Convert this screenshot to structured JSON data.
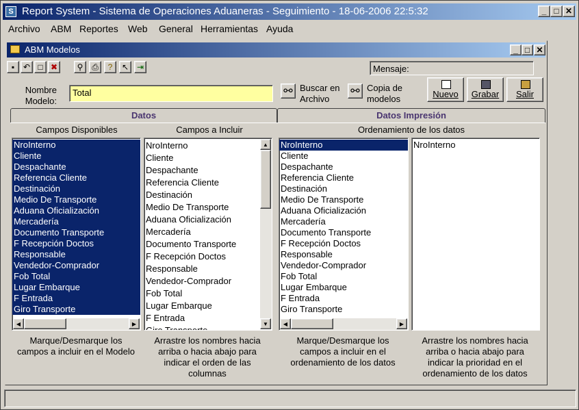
{
  "app": {
    "title": "Report System - Sistema de Operaciones Aduaneras - Seguimiento - 18-06-2006 22:5:32",
    "icon_letter": "S"
  },
  "caption_buttons": {
    "minimize": "_",
    "maximize": "□",
    "close": "✕"
  },
  "menu": [
    "Archivo",
    "ABM",
    "Reportes",
    "Web",
    "General",
    "Herramientas",
    "Ayuda"
  ],
  "child": {
    "title": "ABM Modelos",
    "message_label": "Mensaje:",
    "toolbar_icons": [
      "save-icon",
      "undo-icon",
      "new-document-icon",
      "delete-icon",
      "find-icon",
      "print-icon",
      "help-icon",
      "context-help-icon",
      "exit-icon"
    ]
  },
  "form": {
    "nombre_label_1": "Nombre",
    "nombre_label_2": "Modelo:",
    "nombre_value": "Total",
    "buscar_1": "Buscar en",
    "buscar_2": "Archivo",
    "copia_1": "Copia de",
    "copia_2": "modelos",
    "btn_nuevo": "Nuevo",
    "btn_grabar": "Grabar",
    "btn_salir": "Salir"
  },
  "tabs": {
    "datos": "Datos",
    "impresion": "Datos Impresión"
  },
  "columns": {
    "disponibles": "Campos Disponibles",
    "incluir": "Campos a Incluir",
    "ordenamiento": "Ordenamiento de los datos"
  },
  "lists": {
    "disponibles": [
      "NroInterno",
      "Cliente",
      "Despachante",
      "Referencia Cliente",
      "Destinación",
      "Medio De Transporte",
      "Aduana Oficialización",
      "Mercadería",
      "Documento Transporte",
      "F Recepción Doctos",
      "Responsable",
      "Vendedor-Comprador",
      "Fob Total",
      "Lugar Embarque",
      "F Entrada",
      "Giro Transporte"
    ],
    "incluir": [
      "NroInterno",
      "Cliente",
      "Despachante",
      "Referencia Cliente",
      "Destinación",
      "Medio De Transporte",
      "Aduana Oficialización",
      "Mercadería",
      "Documento Transporte",
      "F Recepción Doctos",
      "Responsable",
      "Vendedor-Comprador",
      "Fob Total",
      "Lugar Embarque",
      "F Entrada",
      "Giro Transporte"
    ],
    "orden_disponibles": [
      "NroInterno",
      "Cliente",
      "Despachante",
      "Referencia Cliente",
      "Destinación",
      "Medio De Transporte",
      "Aduana Oficialización",
      "Mercadería",
      "Documento Transporte",
      "F Recepción Doctos",
      "Responsable",
      "Vendedor-Comprador",
      "Fob Total",
      "Lugar Embarque",
      "F Entrada",
      "Giro Transporte"
    ],
    "orden_seleccionados": [
      "NroInterno"
    ]
  },
  "help": {
    "h1": [
      "Marque/Desmarque los",
      "campos a incluir en el Modelo"
    ],
    "h2": [
      "Arrastre los nombres hacia",
      "arriba o hacia abajo para",
      "indicar el orden de las",
      "columnas"
    ],
    "h3": [
      "Marque/Desmarque los",
      "campos a incluir en el",
      "ordenamiento de los datos"
    ],
    "h4": [
      "Arrastre los nombres hacia",
      "arriba o hacia abajo para",
      "indicar la prioridad en el",
      "ordenamiento de los datos"
    ]
  },
  "colors": {
    "selection": "#0a246a",
    "input_bg": "#ffffa0",
    "tab_text": "#4a3570"
  }
}
